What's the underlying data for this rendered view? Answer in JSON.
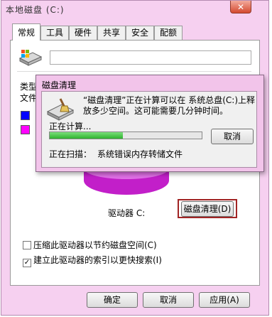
{
  "window": {
    "title": "本地磁盘 (C:)",
    "close_label": "✕"
  },
  "tabs": [
    {
      "label": "常规",
      "active": true
    },
    {
      "label": "工具"
    },
    {
      "label": "硬件"
    },
    {
      "label": "共享"
    },
    {
      "label": "安全"
    },
    {
      "label": "配额"
    }
  ],
  "general": {
    "name_value": "",
    "type_label": "类型",
    "fs_label": "文件",
    "used_color": "#0000ff",
    "free_color": "#ff00ff",
    "drive_label": "驱动器 C:",
    "cleanup_button": "磁盘清理(D)",
    "compress_option": "压缩此驱动器以节约磁盘空间(C)",
    "compress_checked": false,
    "index_option": "建立此驱动器的索引以更快搜索(I)",
    "index_checked": true
  },
  "footer": {
    "ok": "确定",
    "cancel": "取消",
    "apply": "应用(A)"
  },
  "cleanup_dialog": {
    "title": "磁盘清理",
    "message": "“磁盘清理”正在计算可以在 系统总盘(C:)上释放多少空间。这可能需要几分钟时间。",
    "status": "正在计算...",
    "progress": 0.48,
    "cancel": "取消",
    "scan_label": "正在扫描：",
    "scan_item": "系统错误内存转储文件"
  },
  "colors": {
    "frame": "#f6d0f0",
    "highlight_box": "#a12424",
    "progress": "#2fb32f"
  }
}
